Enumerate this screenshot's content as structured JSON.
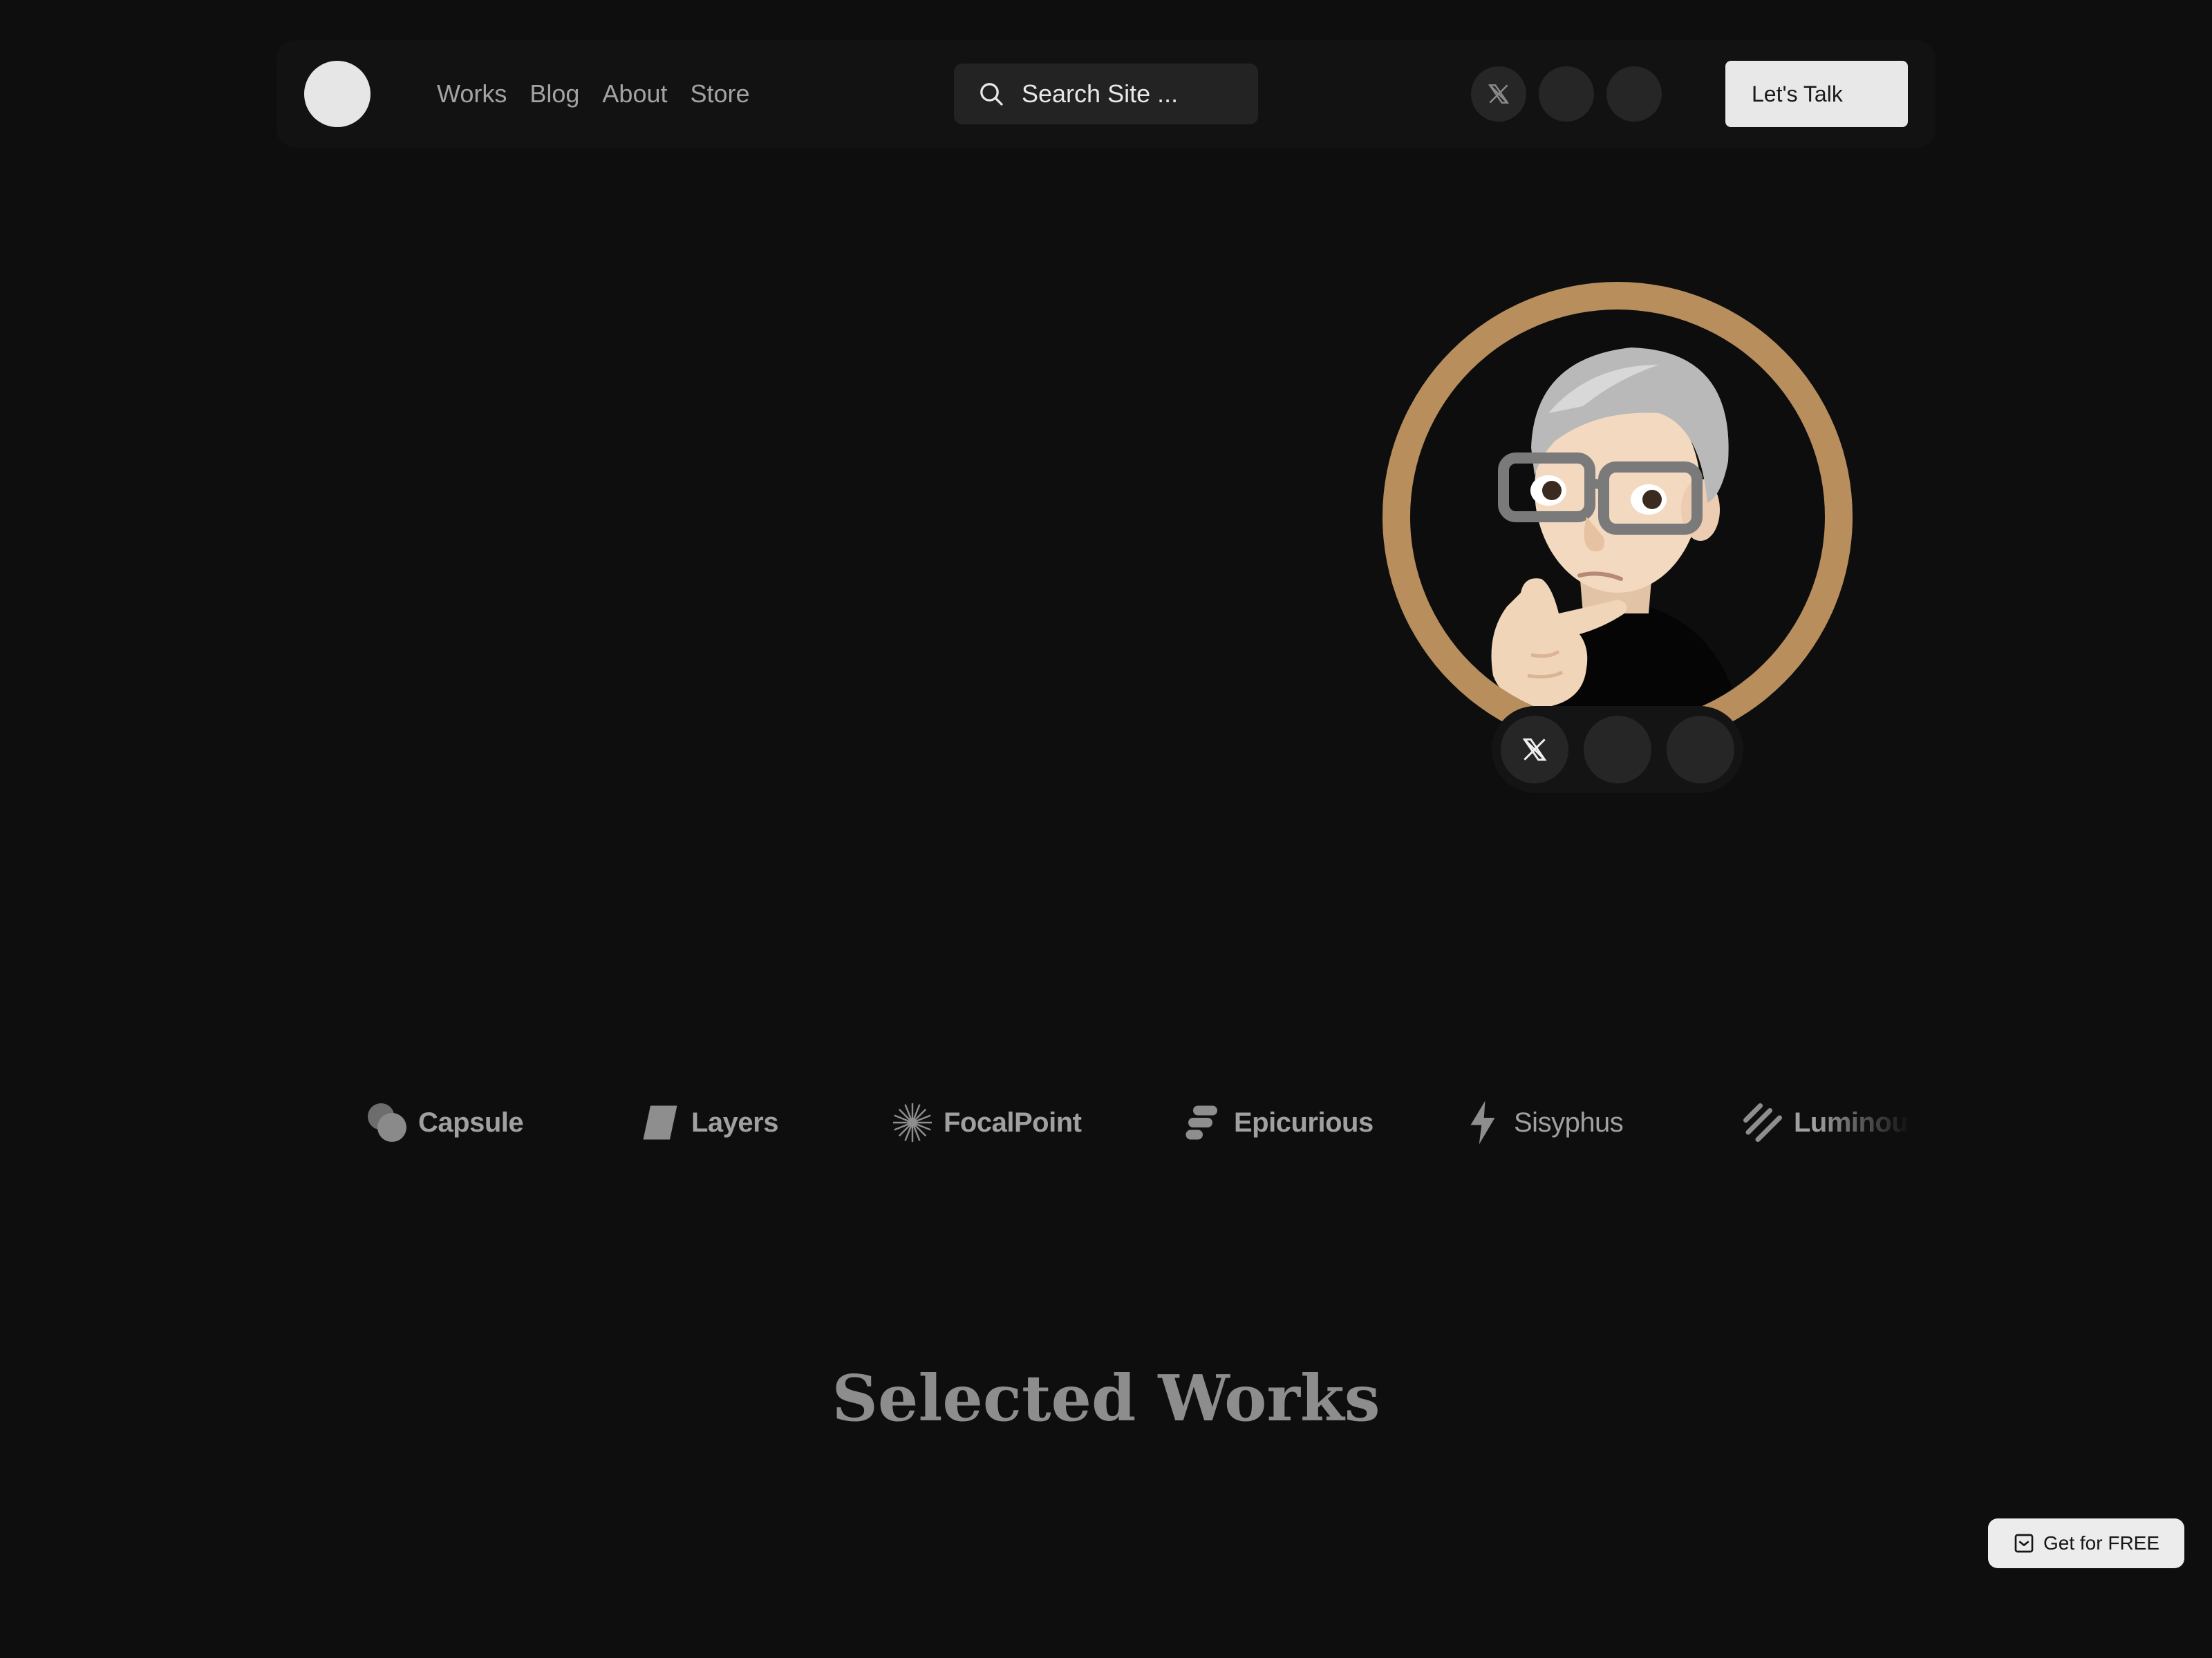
{
  "header": {
    "nav": [
      {
        "label": "Works"
      },
      {
        "label": "Blog"
      },
      {
        "label": "About"
      },
      {
        "label": "Store"
      }
    ],
    "search": {
      "placeholder": "Search Site ...",
      "icon": "search-icon"
    },
    "social": [
      {
        "icon": "x-icon"
      },
      {
        "icon": "blank"
      },
      {
        "icon": "blank"
      }
    ],
    "cta_label": "Let's Talk"
  },
  "hero": {
    "avatar": "memoji-avatar",
    "ring_color": "#b98e5d",
    "social": [
      {
        "icon": "x-icon"
      },
      {
        "icon": "blank"
      },
      {
        "icon": "blank"
      }
    ]
  },
  "brands": [
    {
      "label": "Capsule",
      "icon": "capsule-icon"
    },
    {
      "label": "Layers",
      "icon": "layers-icon"
    },
    {
      "label": "FocalPoint",
      "icon": "focalpoint-icon"
    },
    {
      "label": "Epicurious",
      "icon": "epicurious-icon"
    },
    {
      "label": "Sisyphus",
      "icon": "sisyphus-icon"
    },
    {
      "label": "Luminous",
      "icon": "luminous-icon"
    }
  ],
  "section": {
    "title": "Selected Works"
  },
  "floating_cta": {
    "label": "Get for FREE",
    "icon": "inbox-icon"
  },
  "colors": {
    "background": "#0e0e0e",
    "nav_surface": "#121212",
    "accent": "#b98e5d",
    "button_light": "#e8e8e8"
  }
}
